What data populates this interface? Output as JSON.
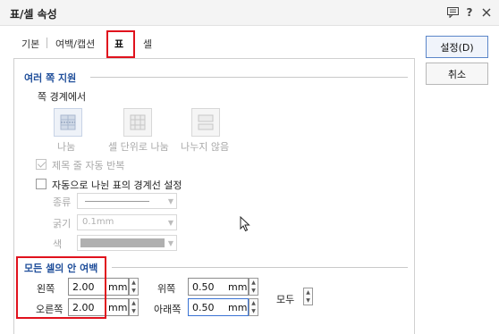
{
  "window": {
    "title": "표/셀 속성",
    "icons": [
      "comment-icon",
      "help-icon",
      "close-icon"
    ],
    "help_label": "?"
  },
  "tabs": [
    {
      "label": "기본",
      "active": false
    },
    {
      "label": "여백/캡션",
      "active": false
    },
    {
      "label": "표",
      "active": true
    },
    {
      "label": "셀",
      "active": false
    }
  ],
  "page_split": {
    "section_title": "여러 쪽 지원",
    "boundary_label": "쪽 경계에서",
    "options": [
      {
        "label": "나눔",
        "icon": "split-icon",
        "selected": true
      },
      {
        "label": "셀 단위로 나눔",
        "icon": "cell-split-icon",
        "selected": false
      },
      {
        "label": "나누지 않음",
        "icon": "no-split-icon",
        "selected": false
      }
    ],
    "auto_repeat_title": {
      "label": "제목 줄 자동 반복",
      "checked": true,
      "enabled": false
    },
    "split_border": {
      "label": "자동으로 나뉜 표의 경계선 설정",
      "checked": false,
      "enabled": true
    },
    "border_type_label": "종류",
    "border_width_label": "굵기",
    "border_width_value": "0.1mm",
    "border_color_label": "색",
    "border_color": "#b0b0b0"
  },
  "cell_margins": {
    "section_title": "모든 셀의 안 여백",
    "left": {
      "label": "왼쪽",
      "value": "2.00",
      "unit": "mm"
    },
    "right": {
      "label": "오른쪽",
      "value": "2.00",
      "unit": "mm"
    },
    "top": {
      "label": "위쪽",
      "value": "0.50",
      "unit": "mm"
    },
    "bottom": {
      "label": "아래쪽",
      "value": "0.50",
      "unit": "mm"
    },
    "all_label": "모두"
  },
  "buttons": {
    "ok": "설정(D)",
    "cancel": "취소"
  },
  "colors": {
    "section_title": "#1f4e9a",
    "highlight": "#e0121d"
  }
}
